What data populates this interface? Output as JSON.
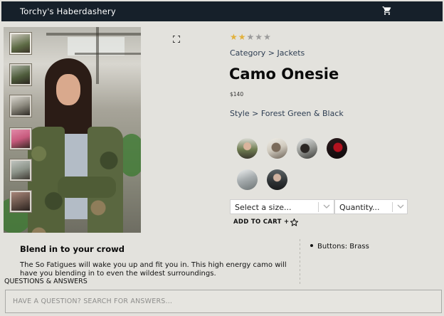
{
  "header": {
    "brand": "Torchy's Haberdashery",
    "cart_icon": "shopping-cart-icon"
  },
  "product": {
    "rating": 2,
    "rating_max": 5,
    "category_text": "Category > Jackets",
    "name": "Camo Onesie",
    "price": "$140",
    "style_text": "Style > Forest Green & Black",
    "style_count": 6,
    "gallery_thumbnail_count": 6,
    "selected_thumbnail": 1
  },
  "selectors": {
    "size_value": "Select a size...",
    "quantity_value": "Quantity..."
  },
  "actions": {
    "add_to_cart": "ADD TO CART +",
    "favorite_icon": "star-outline-icon",
    "expand_icon": "expand-icon"
  },
  "overview": {
    "slogan": "Blend in to your crowd",
    "description": "The So Fatigues will wake you up and fit you in. This high energy camo will have you blending in to even the wildest surroundings.",
    "features": [
      "Buttons: Brass"
    ]
  },
  "qa": {
    "heading": "QUESTIONS & ANSWERS",
    "search_placeholder": "HAVE A QUESTION? SEARCH FOR ANSWERS..."
  },
  "colors": {
    "header_bg": "#16202a",
    "page_bg": "#e3e2dd",
    "star_filled": "#e2b13c",
    "star_empty": "#9b9b9b",
    "link_text": "#2d3d52"
  }
}
